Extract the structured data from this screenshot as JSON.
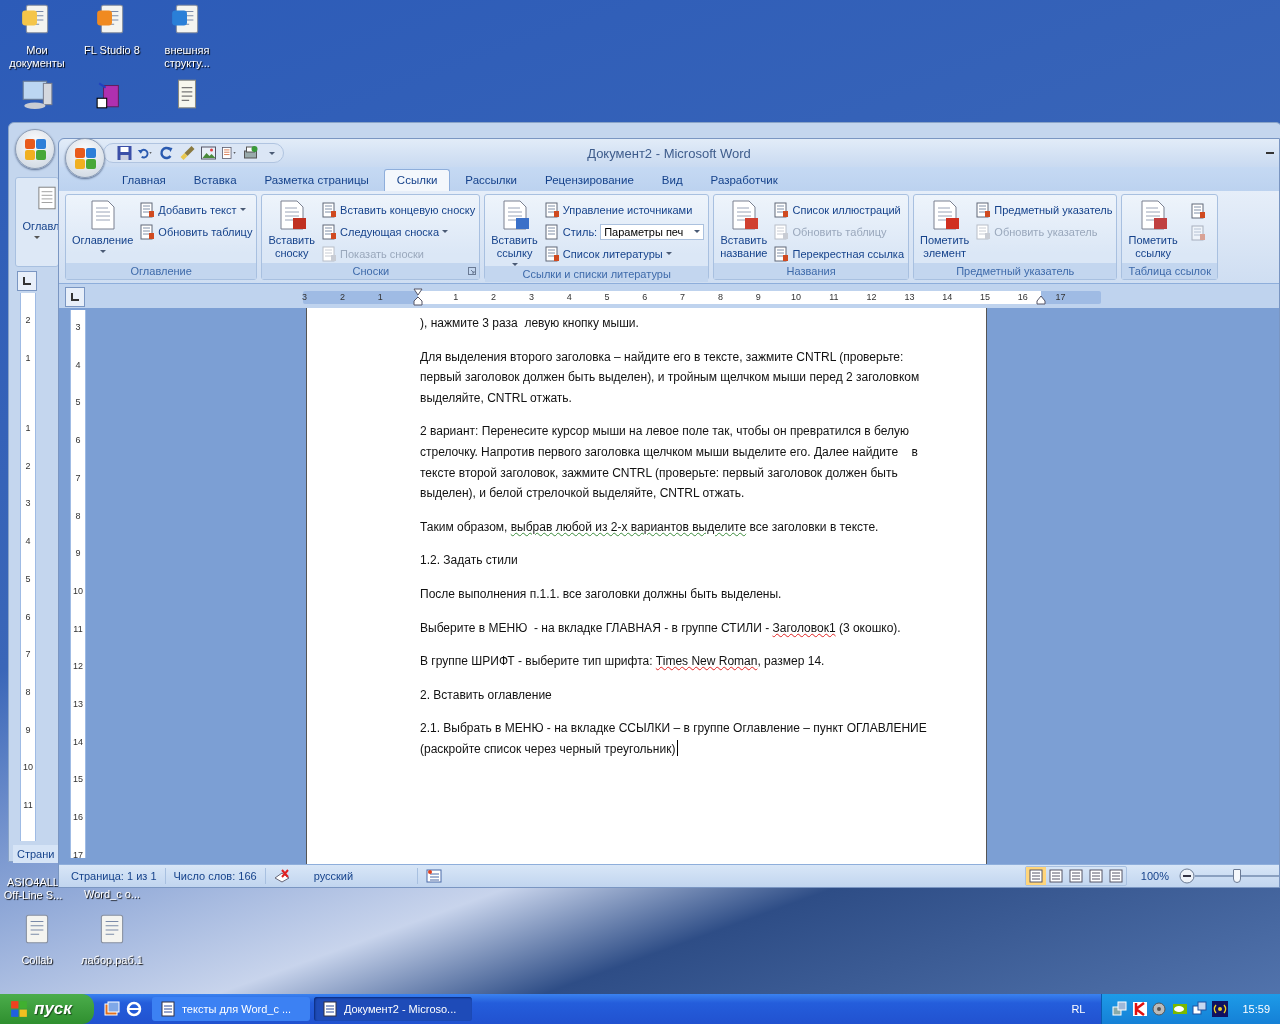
{
  "desktop_icons": [
    {
      "label": "Мои документы"
    },
    {
      "label": "FL Studio 8"
    },
    {
      "label": "внешняя структу..."
    },
    {
      "label": "ASIO4ALL Off-Line S..."
    },
    {
      "label": "Word_c o..."
    },
    {
      "label": "Collab"
    },
    {
      "label": "лабор.раб.1"
    }
  ],
  "back_window": {
    "ribbon_label": "Оглавл",
    "status_text": "Страни",
    "ruler_labels": [
      "2",
      "1",
      "1",
      "2",
      "3",
      "4",
      "5",
      "6",
      "7",
      "8",
      "9",
      "10",
      "11"
    ]
  },
  "window": {
    "title": "Документ2 - Microsoft Word",
    "tabs": [
      {
        "label": "Главная",
        "selected": false
      },
      {
        "label": "Вставка",
        "selected": false
      },
      {
        "label": "Разметка страницы",
        "selected": false
      },
      {
        "label": "Ссылки",
        "selected": true
      },
      {
        "label": "Рассылки",
        "selected": false
      },
      {
        "label": "Рецензирование",
        "selected": false
      },
      {
        "label": "Вид",
        "selected": false
      },
      {
        "label": "Разработчик",
        "selected": false
      }
    ],
    "ribbon_groups": [
      {
        "label": "Оглавление",
        "launcher": false,
        "large": [
          {
            "label": "Оглавление",
            "dropdown": true
          }
        ],
        "small": [
          {
            "kind": "button",
            "label": "Добавить текст",
            "dropdown": true,
            "disabled": false
          },
          {
            "kind": "button",
            "label": "Обновить таблицу",
            "dropdown": false,
            "disabled": false
          }
        ]
      },
      {
        "label": "Сноски",
        "launcher": true,
        "large": [
          {
            "label": "Вставить сноску",
            "dropdown": false
          }
        ],
        "small": [
          {
            "kind": "button",
            "label": "Вставить концевую сноску",
            "dropdown": false,
            "disabled": false
          },
          {
            "kind": "button",
            "label": "Следующая сноска",
            "dropdown": true,
            "disabled": false
          },
          {
            "kind": "button",
            "label": "Показать сноски",
            "dropdown": false,
            "disabled": true
          }
        ]
      },
      {
        "label": "Ссылки и списки литературы",
        "launcher": false,
        "large": [
          {
            "label": "Вставить ссылку",
            "dropdown": true
          }
        ],
        "small": [
          {
            "kind": "button",
            "label": "Управление источниками",
            "dropdown": false,
            "disabled": false
          },
          {
            "kind": "combo",
            "label": "Стиль:",
            "value": "Параметры печ"
          },
          {
            "kind": "button",
            "label": "Список литературы",
            "dropdown": true,
            "disabled": false
          }
        ]
      },
      {
        "label": "Названия",
        "launcher": false,
        "large": [
          {
            "label": "Вставить название",
            "dropdown": false
          }
        ],
        "small": [
          {
            "kind": "button",
            "label": "Список иллюстраций",
            "dropdown": false,
            "disabled": false
          },
          {
            "kind": "button",
            "label": "Обновить таблицу",
            "dropdown": false,
            "disabled": true
          },
          {
            "kind": "button",
            "label": "Перекрестная ссылка",
            "dropdown": false,
            "disabled": false
          }
        ]
      },
      {
        "label": "Предметный указатель",
        "launcher": false,
        "large": [
          {
            "label": "Пометить элемент",
            "dropdown": false
          }
        ],
        "small": [
          {
            "kind": "button",
            "label": "Предметный указатель",
            "dropdown": false,
            "disabled": false
          },
          {
            "kind": "button",
            "label": "Обновить указатель",
            "dropdown": false,
            "disabled": true
          }
        ]
      },
      {
        "label": "Таблица ссылок",
        "launcher": false,
        "large": [
          {
            "label": "Пометить ссылку",
            "dropdown": false
          }
        ],
        "small": [
          {
            "kind": "icon",
            "disabled": false
          },
          {
            "kind": "icon",
            "disabled": true
          }
        ]
      }
    ],
    "ruler": {
      "horizontal_labels": [
        "3",
        "2",
        "1",
        "1",
        "2",
        "3",
        "4",
        "5",
        "6",
        "7",
        "8",
        "9",
        "10",
        "11",
        "12",
        "13",
        "14",
        "15",
        "16",
        "17"
      ],
      "vertical_labels": [
        "3",
        "4",
        "5",
        "6",
        "7",
        "8",
        "9",
        "10",
        "11",
        "12",
        "13",
        "14",
        "15",
        "16",
        "17"
      ]
    },
    "paragraphs": [
      [
        {
          "text": "), нажмите 3 раза  левую кнопку мыши."
        }
      ],
      [
        {
          "text": "Для выделения второго заголовка – найдите его в тексте, зажмите CNTRL (проверьте: первый заголовок должен быть выделен), и тройным щелчком мыши перед 2 заголовком выделяйте, CNTRL отжать."
        }
      ],
      [
        {
          "text": "2 вариант: Перенесите курсор мыши на левое поле так, чтобы он превратился в белую стрелочку. Напротив первого заголовка щелчком мыши выделите его. Далее найдите    в тексте второй заголовок, зажмите CNTRL (проверьте: первый заголовок должен быть выделен), и белой стрелочкой выделяйте, CNTRL отжать."
        }
      ],
      [
        {
          "text": "Таким образом, "
        },
        {
          "text": "выбрав любой из 2-х вариантов выделите",
          "grammar_error": true
        },
        {
          "text": " все заголовки в тексте."
        }
      ],
      [
        {
          "text": "1.2. Задать стили"
        }
      ],
      [
        {
          "text": "После выполнения п.1.1. все заголовки должны быть выделены."
        }
      ],
      [
        {
          "text": "Выберите в МЕНЮ  - на вкладке ГЛАВНАЯ - в группе СТИЛИ - "
        },
        {
          "text": "Заголовок1",
          "spelling_error": true
        },
        {
          "text": " (3 окошко)."
        }
      ],
      [
        {
          "text": "В группе ШРИФТ - выберите тип шрифта: "
        },
        {
          "text": "Times New Roman",
          "spelling_error": true
        },
        {
          "text": ", размер 14."
        }
      ],
      [
        {
          "text": "2. Вставить оглавление"
        }
      ],
      [
        {
          "text": "2.1. Выбрать в МЕНЮ - на вкладке ССЫЛКИ – в группе Оглавление – пункт ОГЛАВЛЕНИЕ (раскройте список через черный треугольник)"
        }
      ]
    ],
    "status_bar": {
      "page": "Страница: 1 из 1",
      "words": "Число слов: 166",
      "language": "русский",
      "view_buttons": [
        {
          "selected": true
        },
        {
          "selected": false
        },
        {
          "selected": false
        },
        {
          "selected": false
        },
        {
          "selected": false
        }
      ],
      "zoom": "100%",
      "zoom_slider": {
        "level": 0.5
      }
    }
  },
  "taskbar": {
    "start": "пуск",
    "tasks": [
      {
        "label": "тексты для Word_c ...",
        "selected": false
      },
      {
        "label": "Документ2 - Microso...",
        "selected": true
      }
    ],
    "language": "RL",
    "clock": "15:59"
  }
}
